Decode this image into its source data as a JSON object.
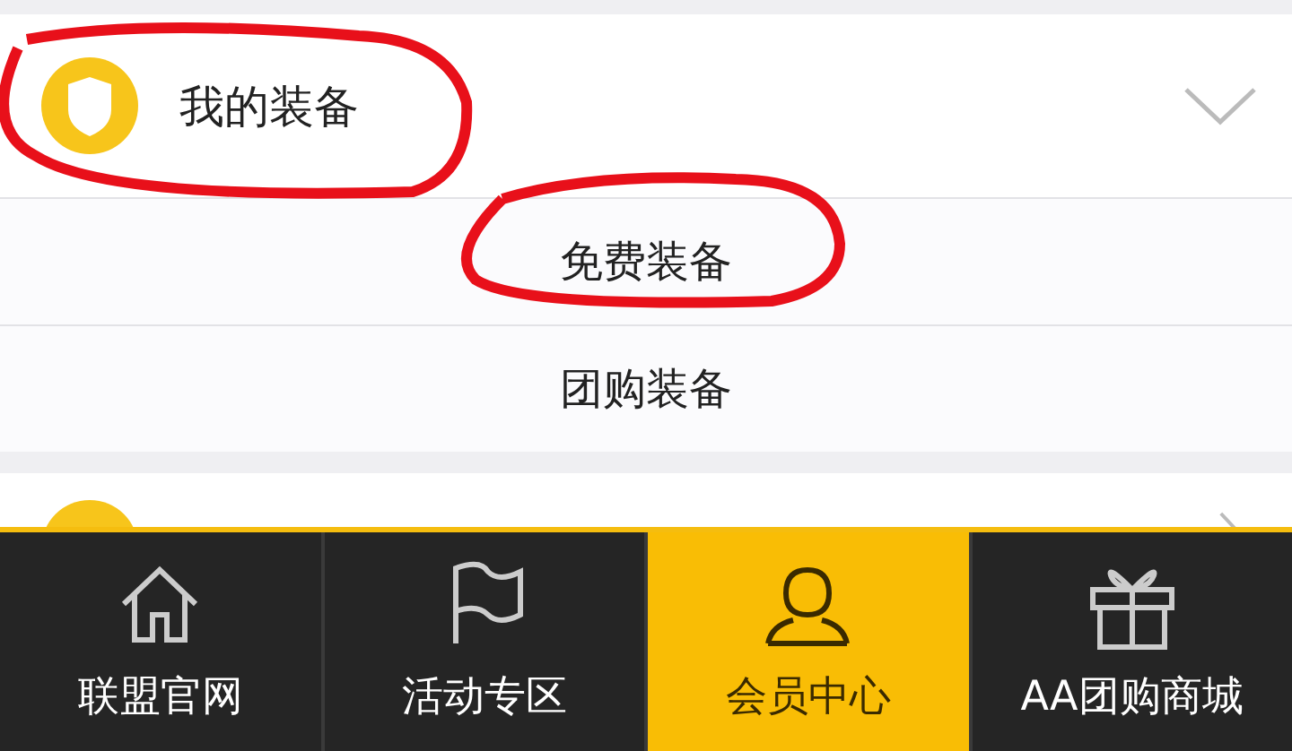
{
  "section": {
    "title": "我的装备",
    "expanded": true,
    "items": [
      {
        "label": "免费装备"
      },
      {
        "label": "团购装备"
      }
    ]
  },
  "tabs": [
    {
      "label": "联盟官网",
      "kind": "home",
      "selected": false
    },
    {
      "label": "活动专区",
      "kind": "flag",
      "selected": false
    },
    {
      "label": "会员中心",
      "kind": "person",
      "selected": true
    },
    {
      "label": "AA团购商城",
      "kind": "gift",
      "selected": false
    }
  ]
}
